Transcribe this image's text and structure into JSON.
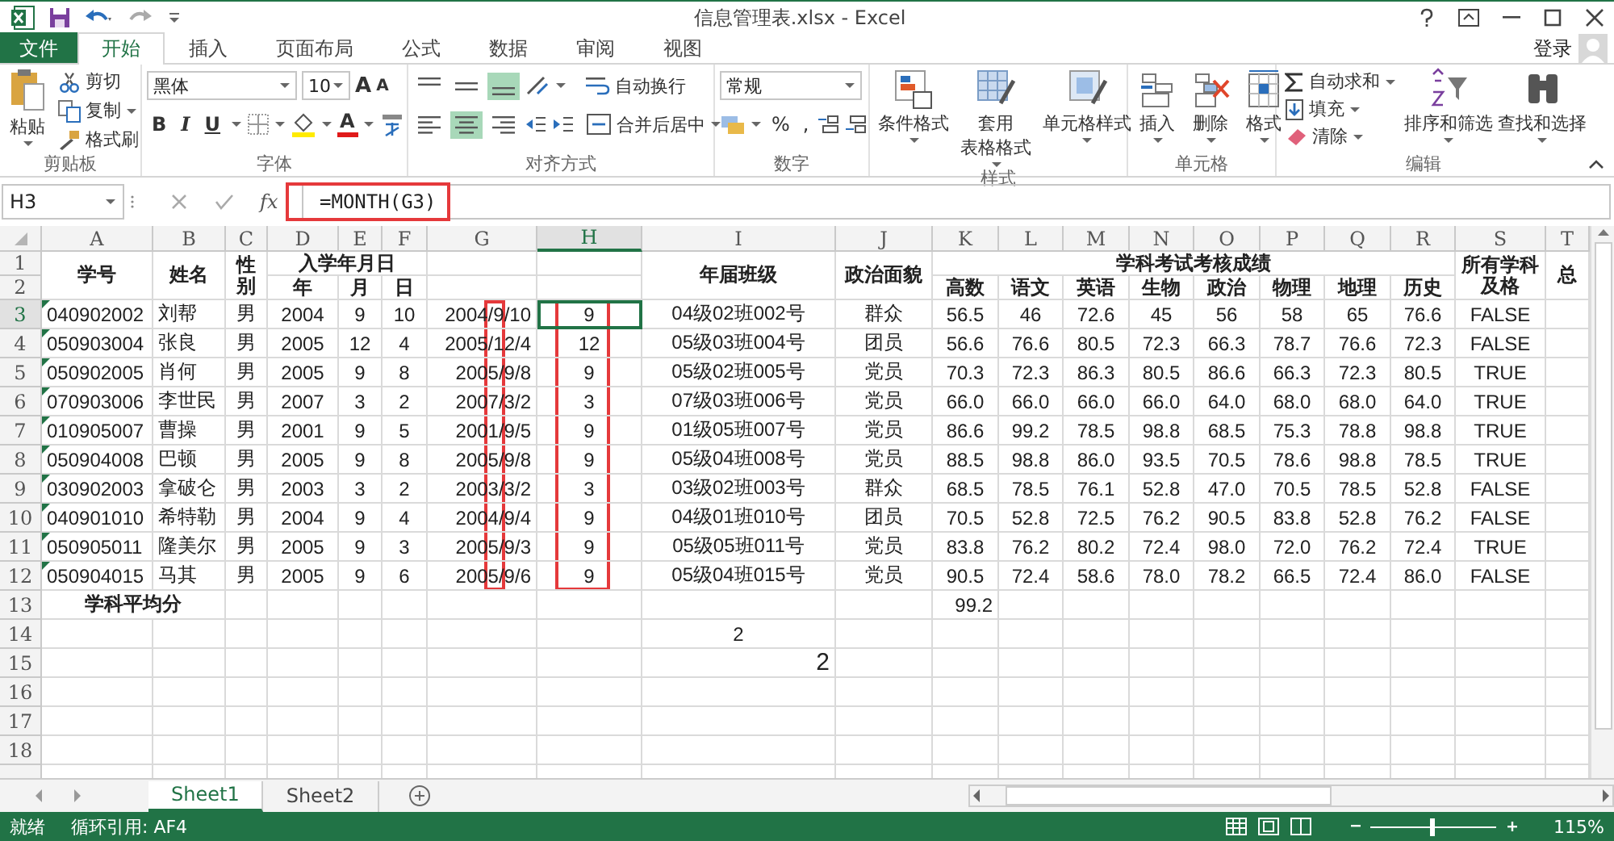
{
  "title_bar": {
    "title": "信息管理表.xlsx - Excel"
  },
  "ribbon_tabs": [
    {
      "label": "文件",
      "kind": "file",
      "selected": false
    },
    {
      "label": "开始",
      "kind": "tab",
      "selected": true
    },
    {
      "label": "插入",
      "kind": "tab",
      "selected": false
    },
    {
      "label": "页面布局",
      "kind": "tab",
      "selected": false
    },
    {
      "label": "公式",
      "kind": "tab",
      "selected": false
    },
    {
      "label": "数据",
      "kind": "tab",
      "selected": false
    },
    {
      "label": "审阅",
      "kind": "tab",
      "selected": false
    },
    {
      "label": "视图",
      "kind": "tab",
      "selected": false
    }
  ],
  "account": {
    "label": "登录"
  },
  "clipboard": {
    "label": "剪贴板",
    "paste": "粘贴",
    "cut": "剪切",
    "copy": "复制",
    "format_painter": "格式刷"
  },
  "font": {
    "label": "字体",
    "name": "黑体",
    "size": "10",
    "grow": "A",
    "shrink": "A",
    "bold": "B",
    "italic": "I",
    "underline": "U",
    "color_letter": "A"
  },
  "alignment": {
    "label": "对齐方式",
    "wrap_text": "自动换行",
    "merge_center": "合并后居中",
    "vertical_options": [
      {
        "selected": false
      },
      {
        "selected": false
      },
      {
        "selected": true
      }
    ],
    "horizontal_options": [
      {
        "selected": false
      },
      {
        "selected": true
      },
      {
        "selected": false
      }
    ]
  },
  "number": {
    "label": "数字",
    "format": "常规",
    "percent": "%",
    "comma": ","
  },
  "styles": {
    "label": "样式",
    "buttons": [
      {
        "lines": [
          "条件格式"
        ]
      },
      {
        "lines": [
          "套用",
          "表格格式"
        ]
      },
      {
        "lines": [
          "单元格样式"
        ]
      }
    ]
  },
  "cells": {
    "label": "单元格",
    "buttons": [
      "插入",
      "删除",
      "格式"
    ]
  },
  "editing": {
    "label": "编辑",
    "autosum": "自动求和",
    "fill": "填充",
    "clear": "清除",
    "sort_filter": "排序和筛选",
    "find_select": "查找和选择"
  },
  "formula_bar": {
    "name_box": "H3",
    "fx": "fx",
    "formula": "=MONTH(G3)",
    "highlighted": true
  },
  "columns": [
    {
      "label": "A",
      "selected": false,
      "highlighted": false
    },
    {
      "label": "B",
      "selected": false,
      "highlighted": false
    },
    {
      "label": "C",
      "selected": false,
      "highlighted": false
    },
    {
      "label": "D",
      "selected": false,
      "highlighted": false
    },
    {
      "label": "E",
      "selected": false,
      "highlighted": false
    },
    {
      "label": "F",
      "selected": false,
      "highlighted": false
    },
    {
      "label": "G",
      "selected": false,
      "highlighted": true
    },
    {
      "label": "H",
      "selected": true,
      "highlighted": true
    },
    {
      "label": "I",
      "selected": false,
      "highlighted": false
    },
    {
      "label": "J",
      "selected": false,
      "highlighted": false
    },
    {
      "label": "K",
      "selected": false,
      "highlighted": false
    },
    {
      "label": "L",
      "selected": false,
      "highlighted": false
    },
    {
      "label": "M",
      "selected": false,
      "highlighted": false
    },
    {
      "label": "N",
      "selected": false,
      "highlighted": false
    },
    {
      "label": "O",
      "selected": false,
      "highlighted": false
    },
    {
      "label": "P",
      "selected": false,
      "highlighted": false
    },
    {
      "label": "Q",
      "selected": false,
      "highlighted": false
    },
    {
      "label": "R",
      "selected": false,
      "highlighted": false
    },
    {
      "label": "S",
      "selected": false,
      "highlighted": false
    },
    {
      "label": "T",
      "selected": false,
      "highlighted": false
    }
  ],
  "row_numbers": [
    {
      "label": "1",
      "selected": false
    },
    {
      "label": "2",
      "selected": false
    },
    {
      "label": "3",
      "selected": true
    },
    {
      "label": "4",
      "selected": false
    },
    {
      "label": "5",
      "selected": false
    },
    {
      "label": "6",
      "selected": false
    },
    {
      "label": "7",
      "selected": false
    },
    {
      "label": "8",
      "selected": false
    },
    {
      "label": "9",
      "selected": false
    },
    {
      "label": "10",
      "selected": false
    },
    {
      "label": "11",
      "selected": false
    },
    {
      "label": "12",
      "selected": false
    },
    {
      "label": "13",
      "selected": false
    },
    {
      "label": "14",
      "selected": false
    },
    {
      "label": "15",
      "selected": false
    },
    {
      "label": "16",
      "selected": false
    },
    {
      "label": "17",
      "selected": false
    },
    {
      "label": "18",
      "selected": false
    }
  ],
  "headers": {
    "id": "学号",
    "name": "姓名",
    "gender": "性别",
    "enrollment_date": "入学年月日",
    "date_parts": [
      "年",
      "月",
      "日"
    ],
    "class": "年届班级",
    "political_status": "政治面貌",
    "scores": "学科考试考核成绩",
    "subjects": [
      "高数",
      "语文",
      "英语",
      "生物",
      "政治",
      "物理",
      "地理",
      "历史"
    ],
    "all_pass": "所有学科及格",
    "total": "总"
  },
  "rows": [
    {
      "values": [
        "040902002",
        "刘帮",
        "男",
        "2004",
        "9",
        "10",
        "2004/9/10",
        "9",
        "04级02班002号",
        "群众",
        "56.5",
        "46",
        "72.6",
        "45",
        "56",
        "58",
        "65",
        "76.6",
        "FALSE"
      ],
      "flagged": true,
      "active_cell": true
    },
    {
      "values": [
        "050903004",
        "张良",
        "男",
        "2005",
        "12",
        "4",
        "2005/12/4",
        "12",
        "05级03班004号",
        "团员",
        "56.6",
        "76.6",
        "80.5",
        "72.3",
        "66.3",
        "78.7",
        "76.6",
        "72.3",
        "FALSE"
      ],
      "flagged": true,
      "active_cell": false
    },
    {
      "values": [
        "050902005",
        "肖何",
        "男",
        "2005",
        "9",
        "8",
        "2005/9/8",
        "9",
        "05级02班005号",
        "党员",
        "70.3",
        "72.3",
        "86.3",
        "80.5",
        "86.6",
        "66.3",
        "72.3",
        "80.5",
        "TRUE"
      ],
      "flagged": true,
      "active_cell": false
    },
    {
      "values": [
        "070903006",
        "李世民",
        "男",
        "2007",
        "3",
        "2",
        "2007/3/2",
        "3",
        "07级03班006号",
        "党员",
        "66.0",
        "66.0",
        "66.0",
        "66.0",
        "64.0",
        "68.0",
        "68.0",
        "64.0",
        "TRUE"
      ],
      "flagged": true,
      "active_cell": false
    },
    {
      "values": [
        "010905007",
        "曹操",
        "男",
        "2001",
        "9",
        "5",
        "2001/9/5",
        "9",
        "01级05班007号",
        "党员",
        "86.6",
        "99.2",
        "78.5",
        "98.8",
        "68.5",
        "75.3",
        "78.8",
        "98.8",
        "TRUE"
      ],
      "flagged": true,
      "active_cell": false
    },
    {
      "values": [
        "050904008",
        "巴顿",
        "男",
        "2005",
        "9",
        "8",
        "2005/9/8",
        "9",
        "05级04班008号",
        "党员",
        "88.5",
        "98.8",
        "86.0",
        "93.5",
        "70.5",
        "78.6",
        "98.8",
        "78.5",
        "TRUE"
      ],
      "flagged": true,
      "active_cell": false
    },
    {
      "values": [
        "030902003",
        "拿破仑",
        "男",
        "2003",
        "3",
        "2",
        "2003/3/2",
        "3",
        "03级02班003号",
        "群众",
        "68.5",
        "78.5",
        "76.1",
        "52.8",
        "47.0",
        "70.5",
        "78.5",
        "52.8",
        "FALSE"
      ],
      "flagged": true,
      "active_cell": false
    },
    {
      "values": [
        "040901010",
        "希特勒",
        "男",
        "2004",
        "9",
        "4",
        "2004/9/4",
        "9",
        "04级01班010号",
        "团员",
        "70.5",
        "52.8",
        "72.5",
        "76.2",
        "90.5",
        "83.8",
        "52.8",
        "76.2",
        "FALSE"
      ],
      "flagged": true,
      "active_cell": false
    },
    {
      "values": [
        "050905011",
        "隆美尔",
        "男",
        "2005",
        "9",
        "3",
        "2005/9/3",
        "9",
        "05级05班011号",
        "党员",
        "83.8",
        "76.2",
        "80.2",
        "72.4",
        "98.0",
        "72.0",
        "76.2",
        "72.4",
        "TRUE"
      ],
      "flagged": true,
      "active_cell": false
    },
    {
      "values": [
        "050904015",
        "马其",
        "男",
        "2005",
        "9",
        "6",
        "2005/9/6",
        "9",
        "05级04班015号",
        "党员",
        "90.5",
        "72.4",
        "58.6",
        "78.0",
        "78.2",
        "66.5",
        "72.4",
        "86.0",
        "FALSE"
      ],
      "flagged": true,
      "active_cell": false
    }
  ],
  "summary": {
    "label": "学科平均分",
    "average": "99.2"
  },
  "loose_values": [
    "2",
    "2"
  ],
  "sheet_tabs": [
    {
      "label": "Sheet1",
      "selected": true
    },
    {
      "label": "Sheet2",
      "selected": false
    }
  ],
  "status_bar": {
    "ready": "就绪",
    "circular_reference": "循环引用: AF4",
    "zoom": {
      "level": 0.5,
      "label": "115%"
    }
  }
}
